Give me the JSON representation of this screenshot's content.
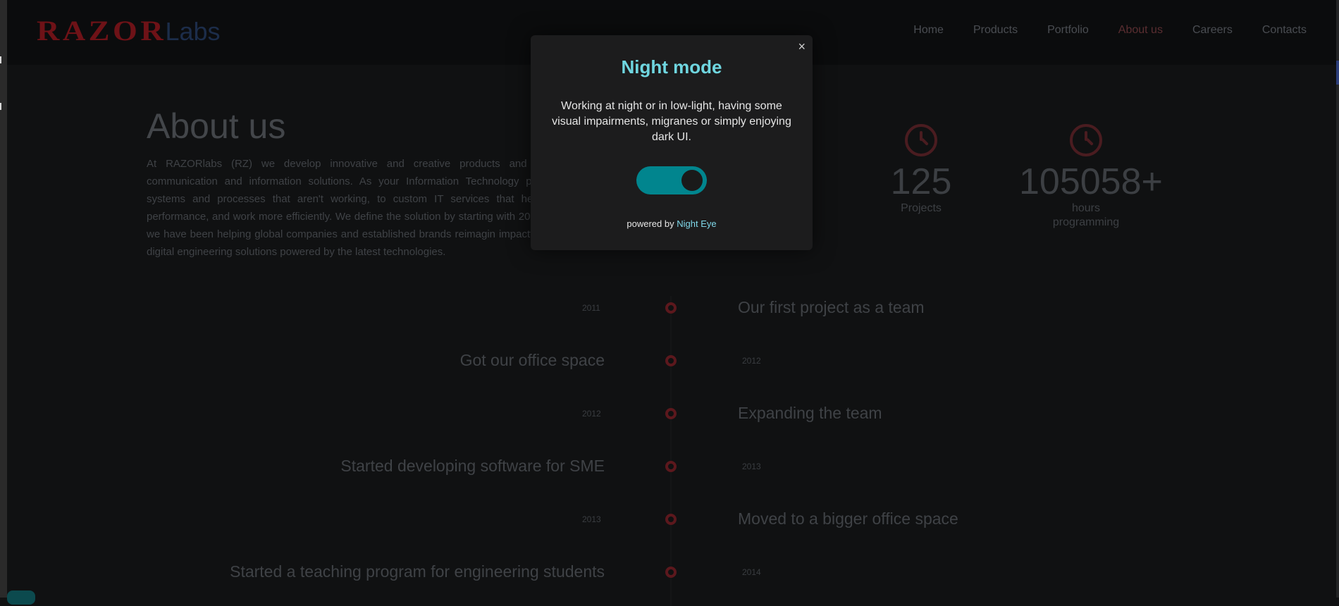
{
  "header": {
    "logo": {
      "primary": "RAZOR",
      "secondary": "Labs"
    },
    "nav": [
      "Home",
      "Products",
      "Portfolio",
      "About us",
      "Careers",
      "Contacts"
    ],
    "active_nav": "About us"
  },
  "about": {
    "title": "About us",
    "text": "At RAZORlabs (RZ) we develop innovative and creative products and s communication and information solutions. As your Information Technology par systems and processes that aren't working, to custom IT services that help performance, and work more efficiently. We define the solution by starting with 2011 we have been helping global companies and established brands reimagin impactful digital engineering solutions powered by the latest technologies."
  },
  "stats": [
    {
      "number": "125",
      "label": "Projects",
      "icon": "clock-icon"
    },
    {
      "number": "105058+",
      "label": "hours programming",
      "icon": "clock-icon"
    }
  ],
  "timeline": [
    {
      "year": "2011",
      "event": "Our first project as a team",
      "side": "right"
    },
    {
      "year": "2012",
      "event": "Got our office space",
      "side": "left"
    },
    {
      "year": "2012",
      "event": "Expanding the team",
      "side": "right"
    },
    {
      "year": "2013",
      "event": "Started developing software for SME",
      "side": "left"
    },
    {
      "year": "2013",
      "event": "Moved to a bigger office space",
      "side": "right"
    },
    {
      "year": "2014",
      "event": "Started a teaching program for engineering students",
      "side": "left"
    }
  ],
  "modal": {
    "close": "×",
    "title": "Night mode",
    "body": "Working at night or in low-light, having some visual impairments, migranes or simply enjoying dark UI.",
    "toggle_on": true,
    "footer_prefix": "powered by",
    "footer_brand": "Night Eye"
  },
  "colors": {
    "accent": "#01858e",
    "modal_title": "#6fd6e0",
    "logo_red": "#6e1217",
    "timeline_dot": "#5c181d"
  }
}
